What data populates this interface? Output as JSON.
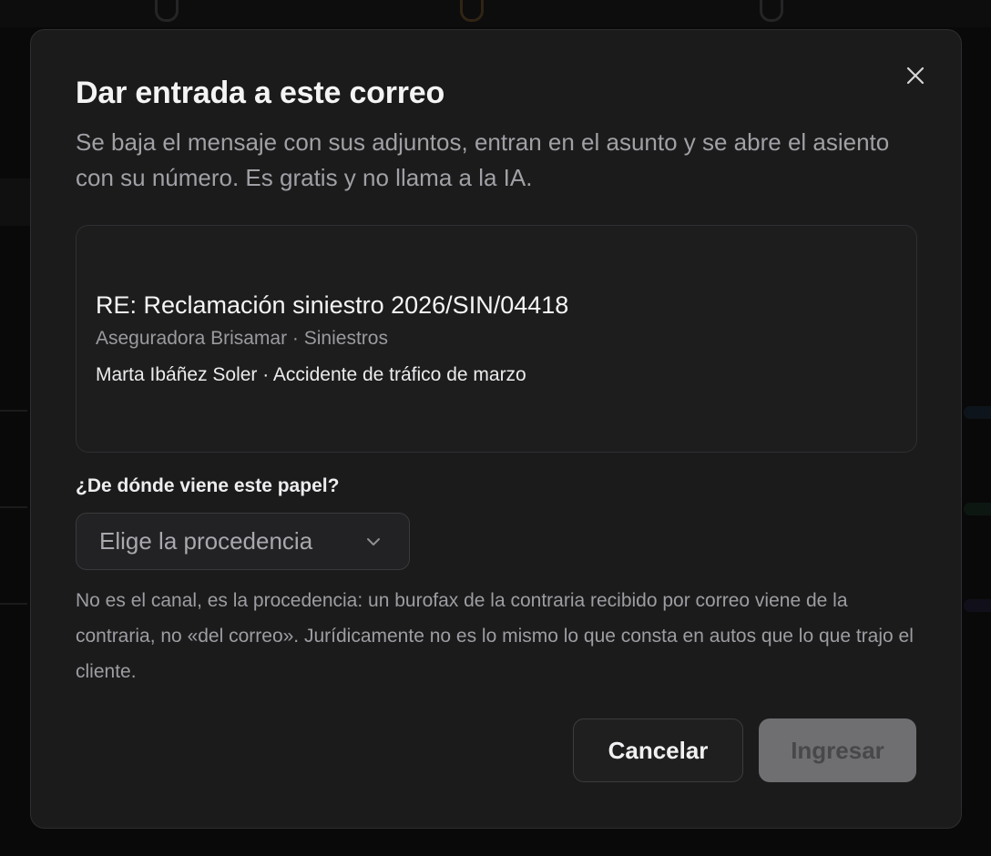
{
  "dialog": {
    "title": "Dar entrada a este correo",
    "subtitle": "Se baja el mensaje con sus adjuntos, entran en el asunto y se abre el asiento con su número. Es gratis y no llama a la IA.",
    "close_icon": "close-icon"
  },
  "email": {
    "subject": "RE: Reclamación siniestro 2026/SIN/04418",
    "from": "Aseguradora Brisamar · Siniestros",
    "description": "Marta Ibáñez Soler · Accidente de tráfico de marzo"
  },
  "origin_field": {
    "label": "¿De dónde viene este papel?",
    "placeholder": "Elige la procedencia",
    "help": "No es el canal, es la procedencia: un burofax de la contraria recibido por correo viene de la contraria, no «del correo». Jurídicamente no es lo mismo lo que consta en autos que lo que trajo el cliente."
  },
  "actions": {
    "cancel_label": "Cancelar",
    "submit_label": "Ingresar",
    "submit_enabled": false
  },
  "colors": {
    "modal_bg": "#1b1b1c",
    "submit_disabled_bg": "#6f6f72"
  }
}
